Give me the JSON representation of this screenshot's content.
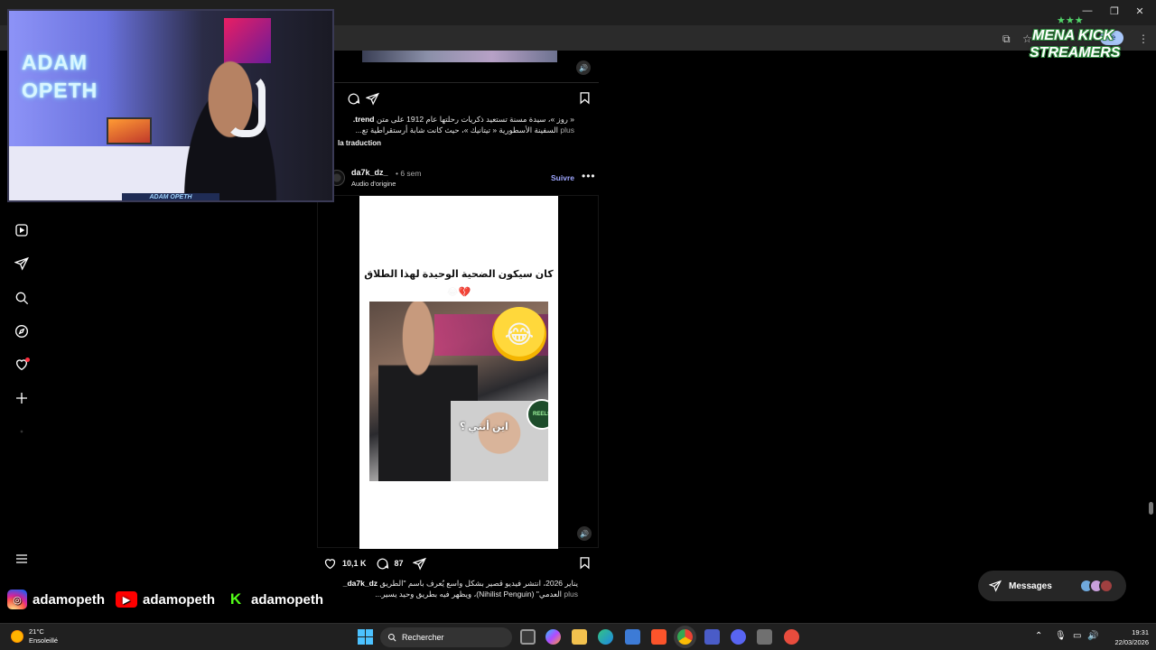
{
  "browser": {
    "win_minimize": "—",
    "win_restore": "❐",
    "win_close": "✕",
    "profile_label": "se"
  },
  "instagram": {
    "nav": [
      "reels-icon",
      "messages-icon",
      "search-icon",
      "explore-icon",
      "notifications-icon",
      "create-icon",
      "profile-icon",
      "more-menu-icon"
    ],
    "previous_post": {
      "caption_user": "trend.",
      "caption_line1": "« روز »، سيدة مسنة تستعيد ذكريات رحلتها عام 1912 على متن",
      "caption_line2": "السفينة الأسطورية « تيتانيك »، حيث كانت شابة أرستقراطية تع...",
      "more": "plus",
      "translation": "la traduction"
    },
    "post": {
      "username": "da7k_dz_",
      "time": "• 6 sem",
      "audio": "Audio d'origine",
      "follow": "Suivre",
      "reel_title": "كان سيكون الضحية الوحيدة لهذا الطلاق",
      "reel_emoji": "😂💔",
      "photo_text": "اين أنتي ؟",
      "badge": "REELS",
      "likes": "10,1 K",
      "comments": "87",
      "caption_user": "da7k_dz_",
      "caption_line1": "يناير 2026، انتشر فيديو قصير بشكل واسع يُعرف باسم \"الطريق",
      "caption_line2": "العدمي\" (Nihilist Penguin)، ويظهر فيه بطريق وحيد يسير...",
      "more": "plus"
    },
    "messages_label": "Messages"
  },
  "overlay": {
    "neon_line1": "ADAM",
    "neon_line2": "OPETH",
    "cam_nameplate": "ADAM OPETH",
    "logo_stars": "★★★",
    "logo_line1": "MENA KICK",
    "logo_line2": "STREAMERS",
    "instagram_handle": "adamopeth",
    "youtube_handle": "adamopeth",
    "kick_handle": "adamopeth"
  },
  "taskbar": {
    "temperature": "21°C",
    "weather": "Ensoleillé",
    "search_placeholder": "Rechercher",
    "time": "19:31",
    "date": "22/03/2026"
  },
  "colors": {
    "accent_follow": "#9fa7ff",
    "notif_red": "#ff3040",
    "windows_blue": "#4cc2ff",
    "kick_green": "#53fc18"
  }
}
